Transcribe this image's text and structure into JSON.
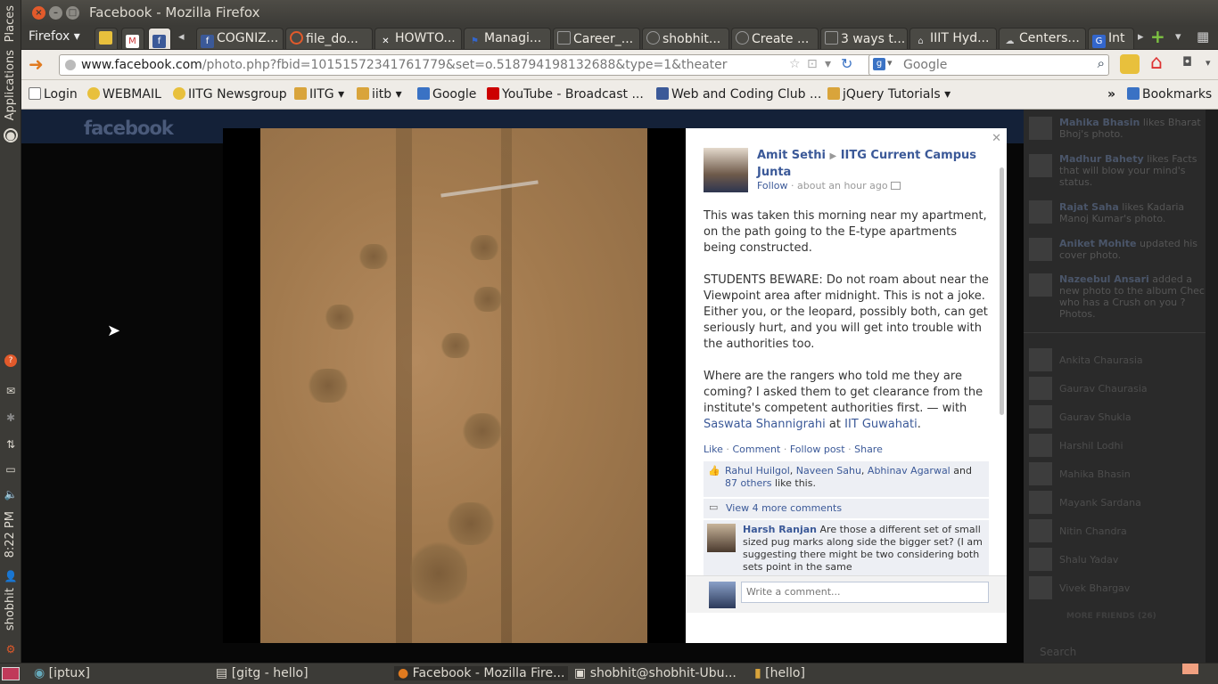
{
  "launcher": {
    "places_label": "Places",
    "applications_label": "Applications",
    "clock": "8:22 PM",
    "user_name": "shobhit"
  },
  "window": {
    "title": "Facebook - Mozilla Firefox"
  },
  "firefox_menu": "Firefox",
  "tabs": [
    "COGNIZ...",
    "file_do...",
    "HOWTO...",
    "Managi...",
    "Career_...",
    "shobhit...",
    "Create ...",
    "3 ways t...",
    "IIIT Hyd...",
    "Centers...",
    "Int"
  ],
  "nav": {
    "url_host": "www.facebook.com",
    "url_path": "/photo.php?fbid=10151572341761779&set=o.518794198132688&type=1&theater",
    "search_placeholder": "Google"
  },
  "bookmarks": [
    "Login",
    "WEBMAIL",
    "IITG Newsgroup",
    "IITG",
    "iitb",
    "Google",
    "YouTube - Broadcast ...",
    "Web and Coding Club ...",
    "jQuery Tutorials",
    "Bookmarks"
  ],
  "facebook": {
    "logo": "facebook"
  },
  "post": {
    "author": "Amit Sethi",
    "group": "IITG Current Campus Junta",
    "follow": "Follow",
    "time": "about an hour ago",
    "para1": "This was taken this morning near my apartment, on the path going to the E-type apartments being constructed.",
    "para2": "STUDENTS BEWARE: Do not roam about near the Viewpoint area after midnight. This is not a joke. Either you, or the leopard, possibly both, can get seriously hurt, and you will get into trouble with the authorities too.",
    "para3": "Where are the rangers who told me they are coming? I asked them to get clearance from the institute's competent authorities first. —",
    "with_prefix": "with",
    "with_person": "Saswata Shannigrahi",
    "at_word": "at",
    "at_place": "IIT Guwahati",
    "actions": [
      "Like",
      "Comment",
      "Follow post",
      "Share"
    ],
    "likes_names": [
      "Rahul Huilgol",
      "Naveen Sahu",
      "Abhinav Agarwal"
    ],
    "likes_and": "and",
    "likes_others": "87 others",
    "likes_suffix": "like this.",
    "view_more": "View 4 more comments",
    "comment_author": "Harsh Ranjan",
    "comment_text": "Are those a different set of small sized pug marks along side the bigger set? (I am suggesting there might be two considering both sets point in the same",
    "write_placeholder": "Write a comment..."
  },
  "ticker": [
    {
      "name": "Mahika Bhasin",
      "text": "likes Bharat Bhoj's photo."
    },
    {
      "name": "Madhur Bahety",
      "text": "likes Facts that will blow your mind's status."
    },
    {
      "name": "Rajat Saha",
      "text": "likes Kadaria Manoj Kumar's photo."
    },
    {
      "name": "Aniket Mohite",
      "text": "updated his cover photo."
    },
    {
      "name": "Nazeebul Ansari",
      "text": "added a new photo to the album Check who has a Crush on you ? Photos."
    }
  ],
  "chat": [
    "Ankita Chaurasia",
    "Gaurav Chaurasia",
    "Gaurav Shukla",
    "Harshil Lodhi",
    "Mahika Bhasin",
    "Mayank Sardana",
    "Nitin Chandra",
    "Shalu Yadav",
    "Vivek Bhargav"
  ],
  "chat_more": "MORE FRIENDS (26)",
  "chat_search": "Search",
  "taskbar": [
    "[iptux]",
    "[gitg - hello]",
    "Facebook - Mozilla Fire...",
    "shobhit@shobhit-Ubu...",
    "[hello]"
  ],
  "colors": {
    "fb_blue": "#3b5998",
    "ubuntu_dark": "#3c3b37",
    "close_red": "#e25a2b"
  }
}
